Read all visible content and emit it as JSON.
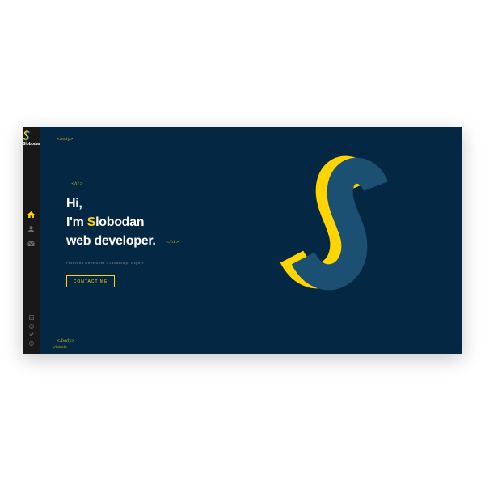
{
  "sidebar": {
    "logo_letter": "S",
    "logo_text": "Slobodan",
    "nav": [
      {
        "name": "home",
        "icon": "home-icon",
        "active": true
      },
      {
        "name": "about",
        "icon": "user-icon",
        "active": false
      },
      {
        "name": "contact",
        "icon": "envelope-icon",
        "active": false
      }
    ],
    "social": [
      "linkedin-icon",
      "github-icon",
      "twitter-icon",
      "skype-icon"
    ]
  },
  "tags": {
    "body_open": "<body>",
    "h1_open": "<h1>",
    "h1_close": "</h1>",
    "body_close": "</body>",
    "html_close": "</html>"
  },
  "hero": {
    "line1": "Hi,",
    "line2_prefix": "I'm ",
    "line2_initial": "S",
    "line2_rest": "lobodan",
    "line3": "web developer.",
    "subtitle": "Frontend Developer / Javascript Expert",
    "cta_label": "CONTACT ME"
  },
  "colors": {
    "accent": "#ffd400",
    "background": "#042744",
    "sidebar": "#181818",
    "logo_blue": "#1b5072",
    "tag": "#c9b512"
  }
}
